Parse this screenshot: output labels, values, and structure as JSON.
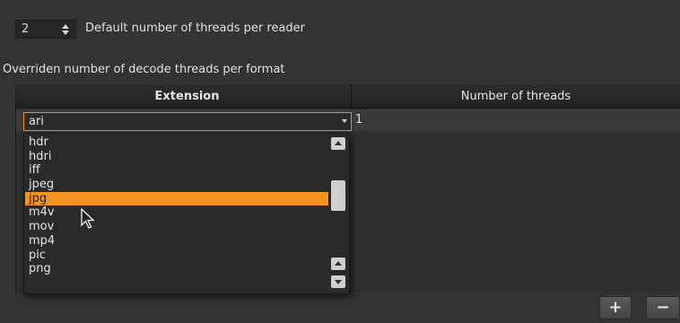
{
  "threads_per_reader": {
    "value": "2",
    "label": "Default number of threads per reader"
  },
  "section_label": "Overriden number of decode threads per format",
  "table": {
    "headers": {
      "extension": "Extension",
      "threads": "Number of threads"
    },
    "editing_row": {
      "extension": "ari",
      "threads": "1"
    }
  },
  "dropdown": {
    "options": [
      "hdr",
      "hdri",
      "iff",
      "jpeg",
      "jpg",
      "m4v",
      "mov",
      "mp4",
      "pic",
      "png"
    ],
    "highlighted": "jpg"
  },
  "buttons": {
    "add": "+",
    "remove": "−"
  },
  "colors": {
    "accent": "#f39420",
    "background": "#333333"
  }
}
